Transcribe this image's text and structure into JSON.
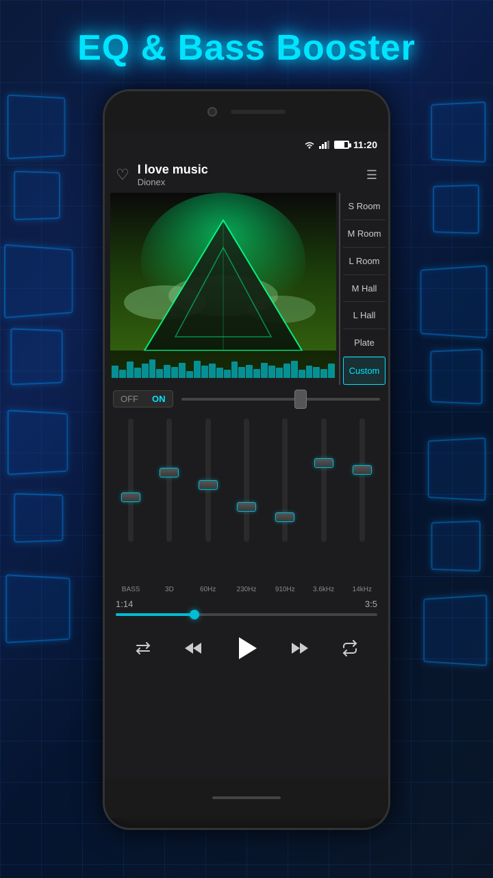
{
  "app": {
    "title": "EQ & Bass Booster"
  },
  "status_bar": {
    "time": "11:20"
  },
  "song": {
    "title": "I love music",
    "artist": "Dionex"
  },
  "presets": [
    {
      "id": "s-room",
      "label": "S Room",
      "active": false
    },
    {
      "id": "m-room",
      "label": "M Room",
      "active": false
    },
    {
      "id": "l-room",
      "label": "L Room",
      "active": false
    },
    {
      "id": "m-hall",
      "label": "M Hall",
      "active": false
    },
    {
      "id": "l-hall",
      "label": "L Hall",
      "active": false
    },
    {
      "id": "plate",
      "label": "Plate",
      "active": false
    },
    {
      "id": "custom",
      "label": "Custom",
      "active": true
    }
  ],
  "toggle": {
    "off_label": "OFF",
    "on_label": "ON"
  },
  "eq": {
    "channels": [
      {
        "label": "BASS",
        "position": 65
      },
      {
        "label": "3D",
        "position": 45
      },
      {
        "label": "60Hz",
        "position": 55
      },
      {
        "label": "230Hz",
        "position": 72
      },
      {
        "label": "910Hz",
        "position": 80
      },
      {
        "label": "3.6kHz",
        "position": 38
      },
      {
        "label": "14kHz",
        "position": 42
      }
    ]
  },
  "progress": {
    "current": "1:14",
    "total": "3:5"
  },
  "controls": {
    "shuffle": "⇌",
    "rewind": "⏮",
    "play": "▶",
    "forward": "⏭",
    "repeat": "↺"
  }
}
